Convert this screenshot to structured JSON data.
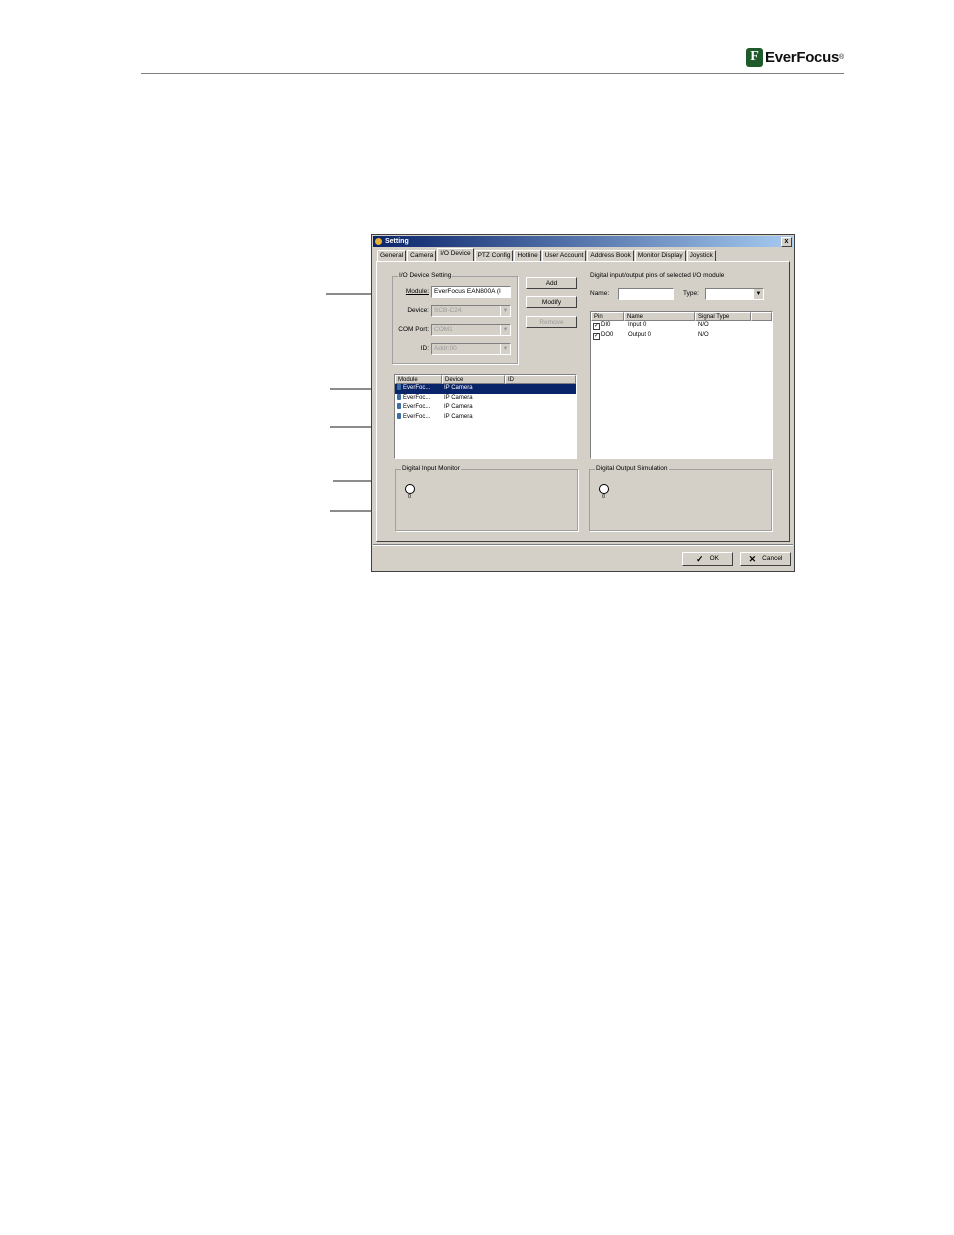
{
  "header": {
    "brand": "EverFocus",
    "reg_mark": "®",
    "brand_mark": "F"
  },
  "dialog": {
    "title": "Setting",
    "close_label": "x",
    "tabs": [
      "General",
      "Camera",
      "I/O Device",
      "PTZ Config",
      "Hotline",
      "User Account",
      "Address Book",
      "Monitor Display",
      "Joystick"
    ],
    "active_tab": "I/O Device",
    "io_setting": {
      "group_title": "I/O Device Setting",
      "module_label": "Module:",
      "module_value": "EverFocus EAN800A (I",
      "device_label": "Device:",
      "device_value": "SCB-C24",
      "com_label": "COM Port:",
      "com_value": "COM1",
      "id_label": "ID:",
      "id_value": "Addr:00"
    },
    "buttons": {
      "add": "Add",
      "modify": "Modify",
      "remove": "Remove",
      "ok": "OK",
      "cancel": "Cancel"
    },
    "module_list": {
      "columns": [
        "Module",
        "Device",
        "ID"
      ],
      "rows": [
        {
          "module": "EverFoc...",
          "device": "IP Camera",
          "id": ""
        },
        {
          "module": "EverFoc...",
          "device": "IP Camera",
          "id": ""
        },
        {
          "module": "EverFoc...",
          "device": "IP Camera",
          "id": ""
        },
        {
          "module": "EverFoc...",
          "device": "IP Camera",
          "id": ""
        }
      ]
    },
    "pins": {
      "title": "Digital input/output pins of selected I/O module",
      "name_label": "Name:",
      "name_value": "",
      "type_label": "Type:",
      "type_value": "",
      "columns": [
        "Pin",
        "Name",
        "Signal Type"
      ],
      "rows": [
        {
          "pin": "DI0",
          "name": "Input 0",
          "signal": "N/O",
          "checked": true
        },
        {
          "pin": "DO0",
          "name": "Output 0",
          "signal": "N/O",
          "checked": true
        }
      ]
    },
    "input_monitor": {
      "title": "Digital Input Monitor",
      "led_label": "0"
    },
    "output_sim": {
      "title": "Digital Output Simulation",
      "led_label": "0"
    }
  }
}
